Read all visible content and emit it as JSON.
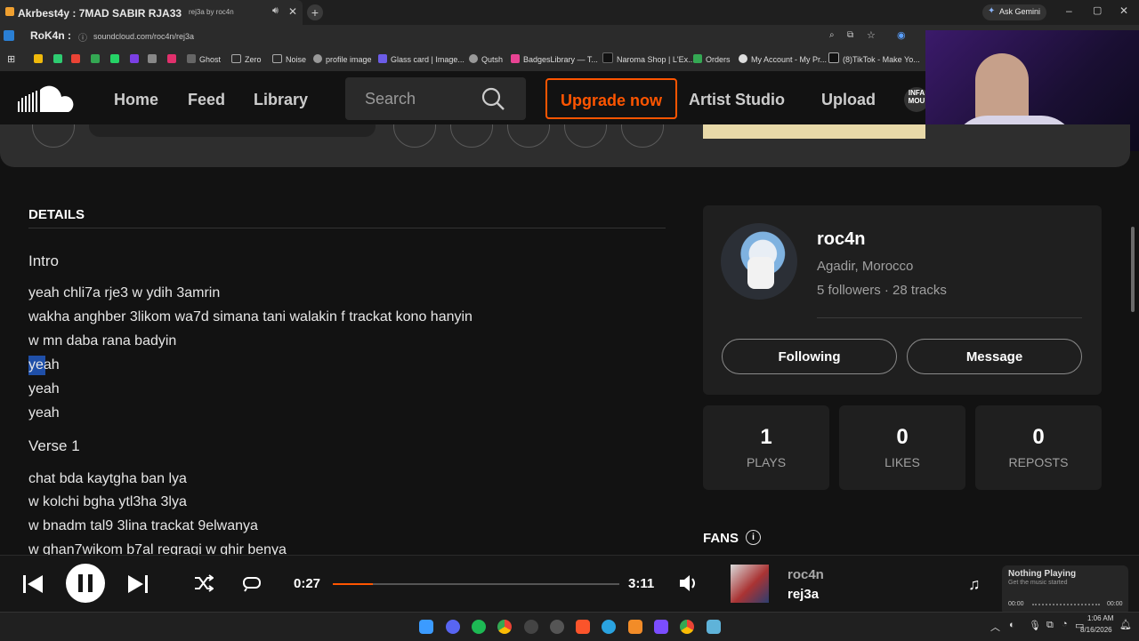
{
  "browser": {
    "tab_title": "Akrbest4y : 7MAD SABIR RJA33",
    "tab_inactive_title": "rej3a by roc4n",
    "ask_gemini": "Ask Gemini",
    "profile_label": "RoK4n :",
    "url": "soundcloud.com/roc4n/rej3a",
    "bookmarks": [
      "Ghost",
      "Zero",
      "Noise",
      "profile image",
      "Glass card | Image...",
      "Qutsh",
      "BadgesLibrary — T...",
      "Naroma Shop | L'Ex...",
      "Orders",
      "My Account - My Pr...",
      "(8)TikTok - Make Yo..."
    ]
  },
  "header": {
    "nav": [
      "Home",
      "Feed",
      "Library"
    ],
    "search_placeholder": "Search",
    "upgrade": "Upgrade now",
    "artist_studio": "Artist Studio",
    "upload": "Upload",
    "avatar_text": "INFA MOU"
  },
  "details": {
    "heading": "DETAILS",
    "sections": [
      {
        "title": "Intro",
        "lines": [
          "yeah chli7a rje3 w ydih 3amrin",
          "wakha anghber 3likom wa7d simana tani walakin f trackat kono hanyin",
          "w mn daba rana badyin",
          "yeah",
          "yeah",
          "yeah"
        ]
      },
      {
        "title": "Verse 1",
        "lines": [
          "chat bda kaytgha ban lya",
          "w kolchi bgha ytl3ha 3lya",
          "w bnadm tal9 3lina trackat 9elwanya",
          "w ghan7wikom b7al regragi w ghir benya"
        ]
      }
    ]
  },
  "artist": {
    "name": "roc4n",
    "location": "Agadir, Morocco",
    "followers": "5 followers",
    "separator": "·",
    "tracks": "28 tracks",
    "following_btn": "Following",
    "message_btn": "Message"
  },
  "stats": [
    {
      "value": "1",
      "label": "PLAYS"
    },
    {
      "value": "0",
      "label": "LIKES"
    },
    {
      "value": "0",
      "label": "REPOSTS"
    }
  ],
  "fans_label": "FANS",
  "player": {
    "elapsed": "0:27",
    "total": "3:11",
    "progress": 0.14,
    "artist": "roc4n",
    "track": "rej3a"
  },
  "media_widget": {
    "title": "Nothing Playing",
    "subtitle": "Get the music started",
    "time_start": "00:00",
    "time_end": "00:00"
  },
  "clock": {
    "time": "1:06 AM",
    "date": "8/16/2026"
  },
  "colors": {
    "accent": "#ff5500",
    "bg": "#121212",
    "card": "#1f1f1f"
  }
}
